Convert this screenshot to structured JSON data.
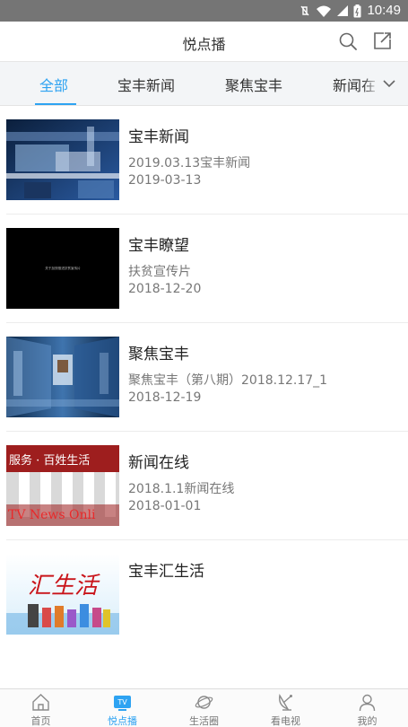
{
  "status_bar": {
    "time": "10:49"
  },
  "header": {
    "title": "悦点播"
  },
  "tabs": [
    {
      "label": "全部",
      "active": true
    },
    {
      "label": "宝丰新闻",
      "active": false
    },
    {
      "label": "聚焦宝丰",
      "active": false
    },
    {
      "label": "新闻在",
      "active": false
    }
  ],
  "items": [
    {
      "title": "宝丰新闻",
      "subtitle": "2019.03.13宝丰新闻",
      "date": "2019-03-13",
      "thumb": "news-studio"
    },
    {
      "title": "宝丰瞭望",
      "subtitle": "扶贫宣传片",
      "date": "2018-12-20",
      "thumb": "black-title-card"
    },
    {
      "title": "聚焦宝丰",
      "subtitle": "聚焦宝丰（第八期）2018.12.17_1",
      "date": "2018-12-19",
      "thumb": "blue-screens"
    },
    {
      "title": "新闻在线",
      "subtitle": "2018.1.1新闻在线",
      "date": "2018-01-01",
      "thumb": "banner",
      "thumb_text_top": "服务 · 百姓生活",
      "thumb_text_bottom": "TV News Onli"
    },
    {
      "title": "宝丰汇生活",
      "subtitle": "",
      "date": "",
      "thumb": "calligraphy",
      "thumb_text": "汇生活"
    }
  ],
  "thumb_card_text": "关于加快推进扶贫宣传片",
  "bottom_nav": [
    {
      "label": "首页",
      "icon": "home-icon",
      "active": false
    },
    {
      "label": "悦点播",
      "icon": "tv-icon",
      "active": true,
      "badge": "TV"
    },
    {
      "label": "生活圈",
      "icon": "planet-icon",
      "active": false
    },
    {
      "label": "看电视",
      "icon": "satellite-dish-icon",
      "active": false
    },
    {
      "label": "我的",
      "icon": "user-icon",
      "active": false
    }
  ],
  "colors": {
    "accent": "#2ea3f2",
    "status_bar": "#757575"
  }
}
